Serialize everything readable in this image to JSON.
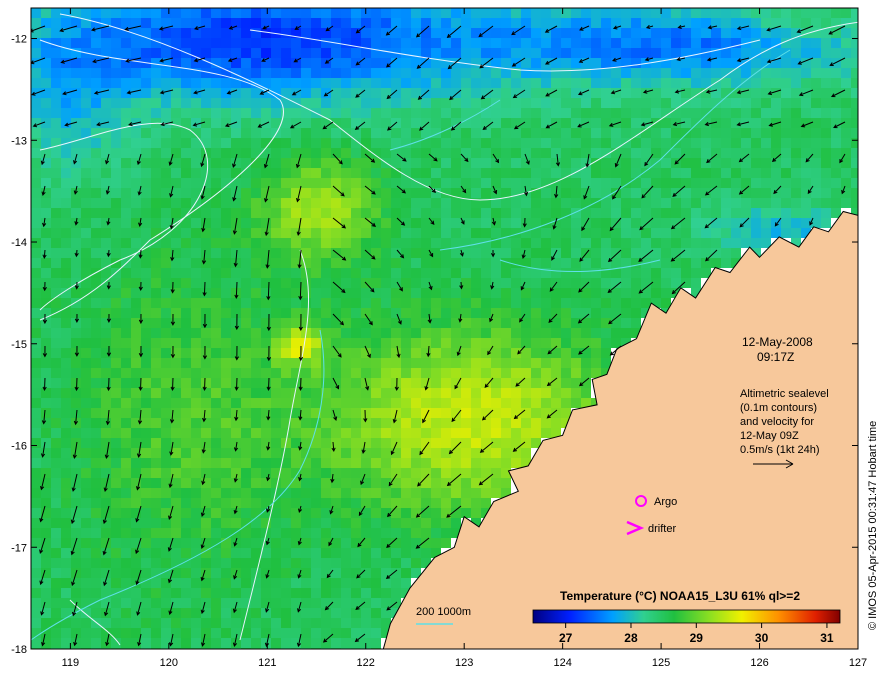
{
  "map": {
    "lon_range": [
      118.6,
      127.0
    ],
    "lat_range": [
      -18.0,
      -11.7
    ],
    "x_ticks": [
      "119",
      "120",
      "121",
      "122",
      "123",
      "124",
      "125",
      "126",
      "127"
    ],
    "y_ticks": [
      "-12",
      "-13",
      "-14",
      "-15",
      "-16",
      "-17",
      "-18"
    ],
    "date_label": "12-May-2008",
    "time_label": "09:17Z",
    "legend_lines": [
      "Altimetric sealevel",
      "(0.1m contours)",
      "and velocity for",
      "12-May 09Z",
      "0.5m/s (1kt 24h)"
    ],
    "argo_label": "Argo",
    "drifter_label": "drifter",
    "depth_label": "200  1000m",
    "colorbar": {
      "title": "Temperature (°C) NOAA15_L3U 61% ql>=2",
      "ticks": [
        "27",
        "28",
        "29",
        "30",
        "31"
      ],
      "range": [
        26.5,
        31.2
      ]
    },
    "credit": "© IMOS 05-Apr-2015 00:31:47 Hobart time",
    "colors": {
      "land": "#f7c89b",
      "coast": "#000000",
      "contour": "#e8f4ff",
      "isobath": "#5fe0e8",
      "marker": "#ff00ff",
      "arrow": "#000000"
    }
  }
}
